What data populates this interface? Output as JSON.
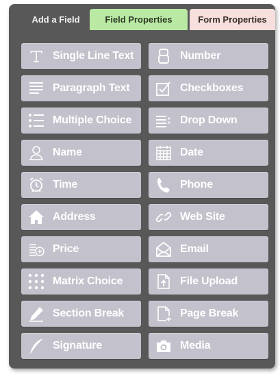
{
  "tabs": {
    "add_field": "Add a Field",
    "field_properties": "Field Properties",
    "form_properties": "Form Properties"
  },
  "colors": {
    "panel": "#585858",
    "button": "#c3c1cb",
    "field_tab": "#b9e9a3",
    "form_tab": "#f6dfdc"
  },
  "fields": [
    {
      "label": "Single Line Text",
      "icon": "single-line-text-icon"
    },
    {
      "label": "Number",
      "icon": "number-icon"
    },
    {
      "label": "Paragraph Text",
      "icon": "paragraph-text-icon"
    },
    {
      "label": "Checkboxes",
      "icon": "checkbox-icon"
    },
    {
      "label": "Multiple Choice",
      "icon": "multiple-choice-icon"
    },
    {
      "label": "Drop Down",
      "icon": "dropdown-icon"
    },
    {
      "label": "Name",
      "icon": "person-icon"
    },
    {
      "label": "Date",
      "icon": "calendar-icon"
    },
    {
      "label": "Time",
      "icon": "alarm-clock-icon"
    },
    {
      "label": "Phone",
      "icon": "phone-icon"
    },
    {
      "label": "Address",
      "icon": "house-icon"
    },
    {
      "label": "Web Site",
      "icon": "link-icon"
    },
    {
      "label": "Price",
      "icon": "coins-icon"
    },
    {
      "label": "Email",
      "icon": "envelope-icon"
    },
    {
      "label": "Matrix Choice",
      "icon": "matrix-icon"
    },
    {
      "label": "File Upload",
      "icon": "upload-icon"
    },
    {
      "label": "Section Break",
      "icon": "pencil-icon"
    },
    {
      "label": "Page Break",
      "icon": "page-break-icon"
    },
    {
      "label": "Signature",
      "icon": "quill-icon"
    },
    {
      "label": "Media",
      "icon": "camera-icon"
    }
  ]
}
